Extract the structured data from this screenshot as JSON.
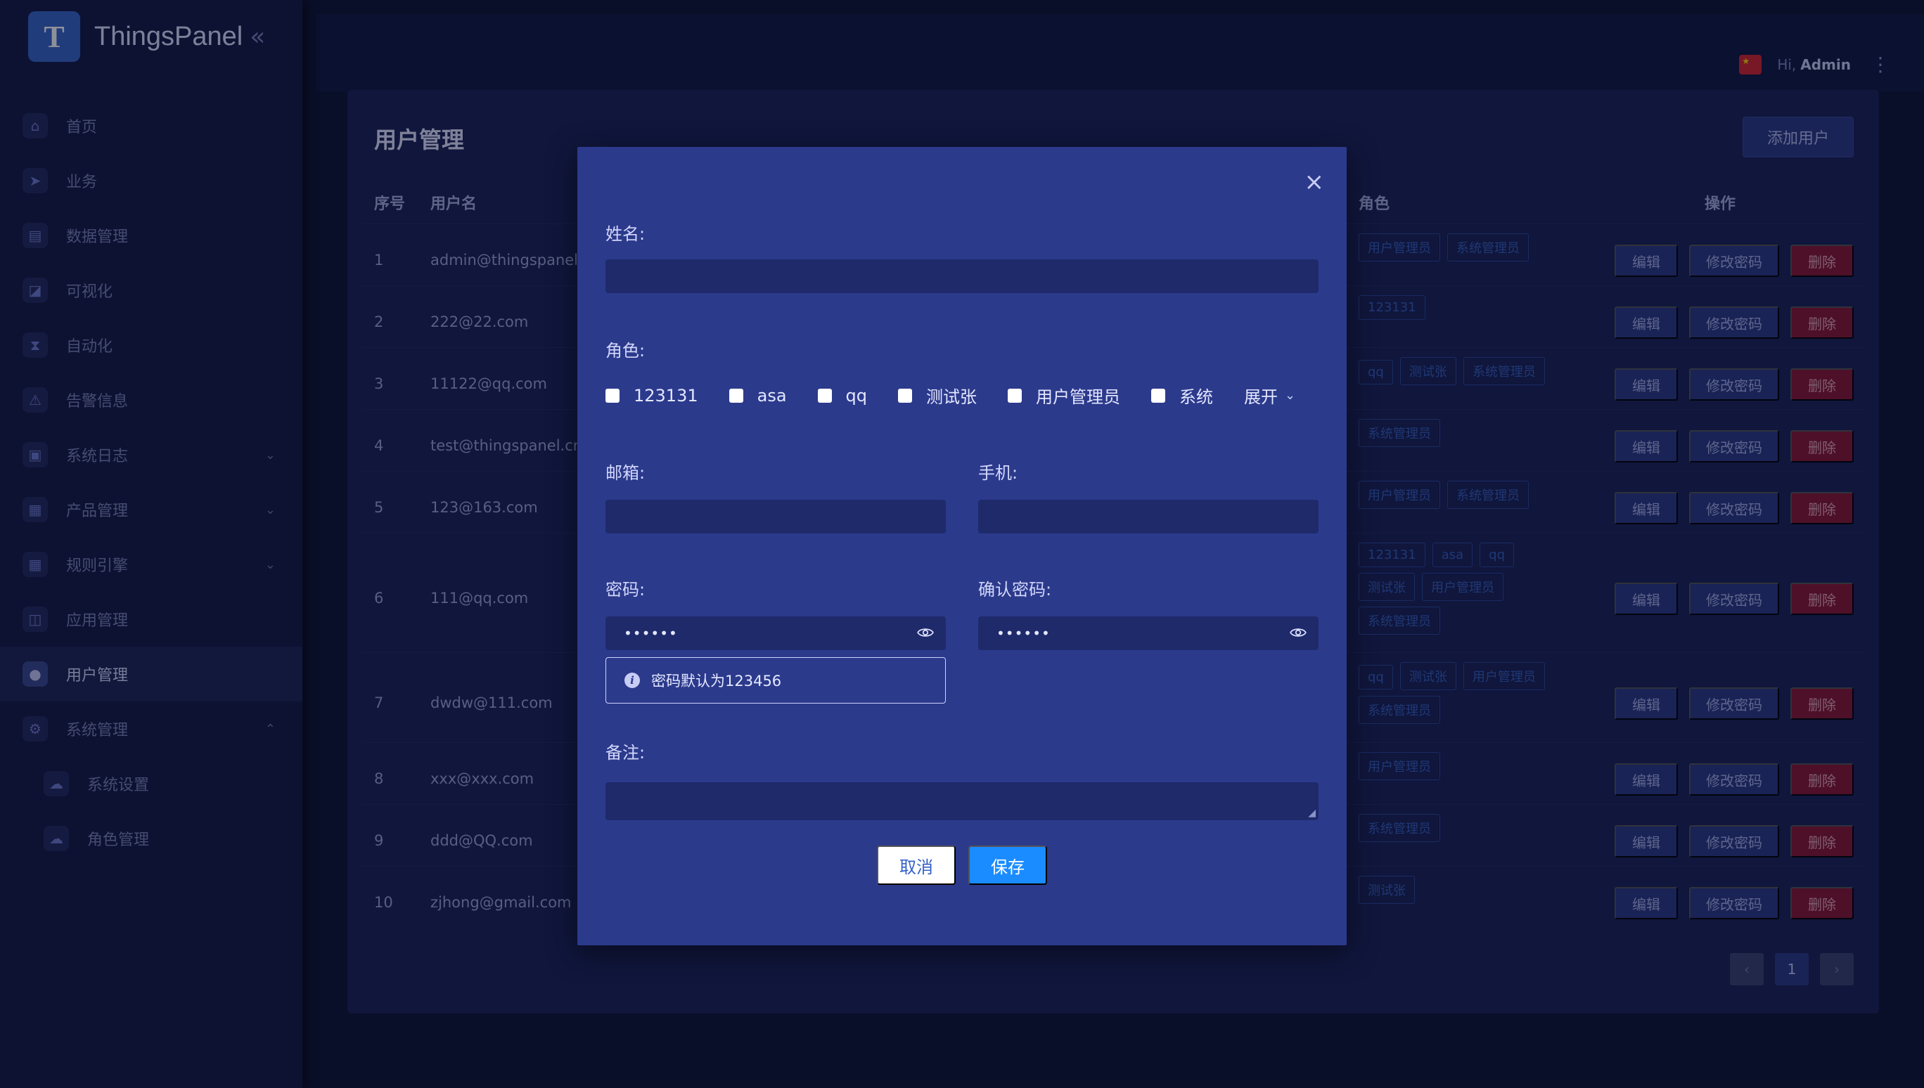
{
  "app": {
    "name": "ThingsPanel",
    "collapse_icon": "«"
  },
  "colors": {
    "accent": "#1a8cff",
    "modal_bg": "#2c3a8c",
    "danger": "#8a1733"
  },
  "sidebar": {
    "items": [
      {
        "label": "首页",
        "icon": "home-icon"
      },
      {
        "label": "业务",
        "icon": "compass-icon"
      },
      {
        "label": "数据管理",
        "icon": "database-icon"
      },
      {
        "label": "可视化",
        "icon": "chart-icon"
      },
      {
        "label": "自动化",
        "icon": "hourglass-icon"
      },
      {
        "label": "告警信息",
        "icon": "warning-icon"
      },
      {
        "label": "系统日志",
        "icon": "log-icon",
        "chevron": "⌄"
      },
      {
        "label": "产品管理",
        "icon": "gift-icon",
        "chevron": "⌄"
      },
      {
        "label": "规则引擎",
        "icon": "gift-icon",
        "chevron": "⌄"
      },
      {
        "label": "应用管理",
        "icon": "basket-icon"
      },
      {
        "label": "用户管理",
        "icon": "user-icon",
        "active": true
      },
      {
        "label": "系统管理",
        "icon": "gear-icon",
        "chevron": "⌃"
      },
      {
        "label": "系统设置",
        "icon": "cloud-icon",
        "sub": true
      },
      {
        "label": "角色管理",
        "icon": "cloud-icon",
        "sub": true
      }
    ]
  },
  "header": {
    "greeting": "Hi,",
    "user": "Admin"
  },
  "page": {
    "title": "用户管理",
    "add_button": "添加用户",
    "columns": {
      "index": "序号",
      "username": "用户名",
      "roles": "角色",
      "actions": "操作"
    },
    "row_actions": {
      "edit": "编辑",
      "change_password": "修改密码",
      "delete": "删除"
    },
    "rows": [
      {
        "index": "1",
        "username": "admin@thingspanel.cn",
        "roles": [
          "用户管理员",
          "系统管理员"
        ]
      },
      {
        "index": "2",
        "username": "222@22.com",
        "roles": [
          "123131"
        ]
      },
      {
        "index": "3",
        "username": "11122@qq.com",
        "roles": [
          "qq",
          "测试张",
          "系统管理员"
        ]
      },
      {
        "index": "4",
        "username": "test@thingspanel.cn",
        "roles": [
          "系统管理员"
        ]
      },
      {
        "index": "5",
        "username": "123@163.com",
        "roles": [
          "用户管理员",
          "系统管理员"
        ]
      },
      {
        "index": "6",
        "username": "111@qq.com",
        "roles": [
          "123131",
          "asa",
          "qq",
          "测试张",
          "用户管理员",
          "系统管理员"
        ]
      },
      {
        "index": "7",
        "username": "dwdw@111.com",
        "roles": [
          "qq",
          "测试张",
          "用户管理员",
          "系统管理员"
        ]
      },
      {
        "index": "8",
        "username": "xxx@xxx.com",
        "roles": [
          "用户管理员"
        ]
      },
      {
        "index": "9",
        "username": "ddd@QQ.com",
        "roles": [
          "系统管理员"
        ]
      },
      {
        "index": "10",
        "username": "zjhong@gmail.com",
        "roles": [
          "测试张"
        ]
      }
    ],
    "pagination": {
      "prev": "‹",
      "current": "1",
      "next": "›"
    }
  },
  "modal": {
    "close": "×",
    "name_label": "姓名:",
    "name_value": "",
    "roles_label": "角色:",
    "role_options": [
      "123131",
      "asa",
      "qq",
      "测试张",
      "用户管理员",
      "系统"
    ],
    "expand_label": "展开",
    "email_label": "邮箱:",
    "phone_label": "手机:",
    "password_label": "密码:",
    "password_value": "••••••",
    "confirm_label": "确认密码:",
    "confirm_value": "••••••",
    "password_hint": "密码默认为123456",
    "remark_label": "备注:",
    "cancel": "取消",
    "save": "保存"
  }
}
